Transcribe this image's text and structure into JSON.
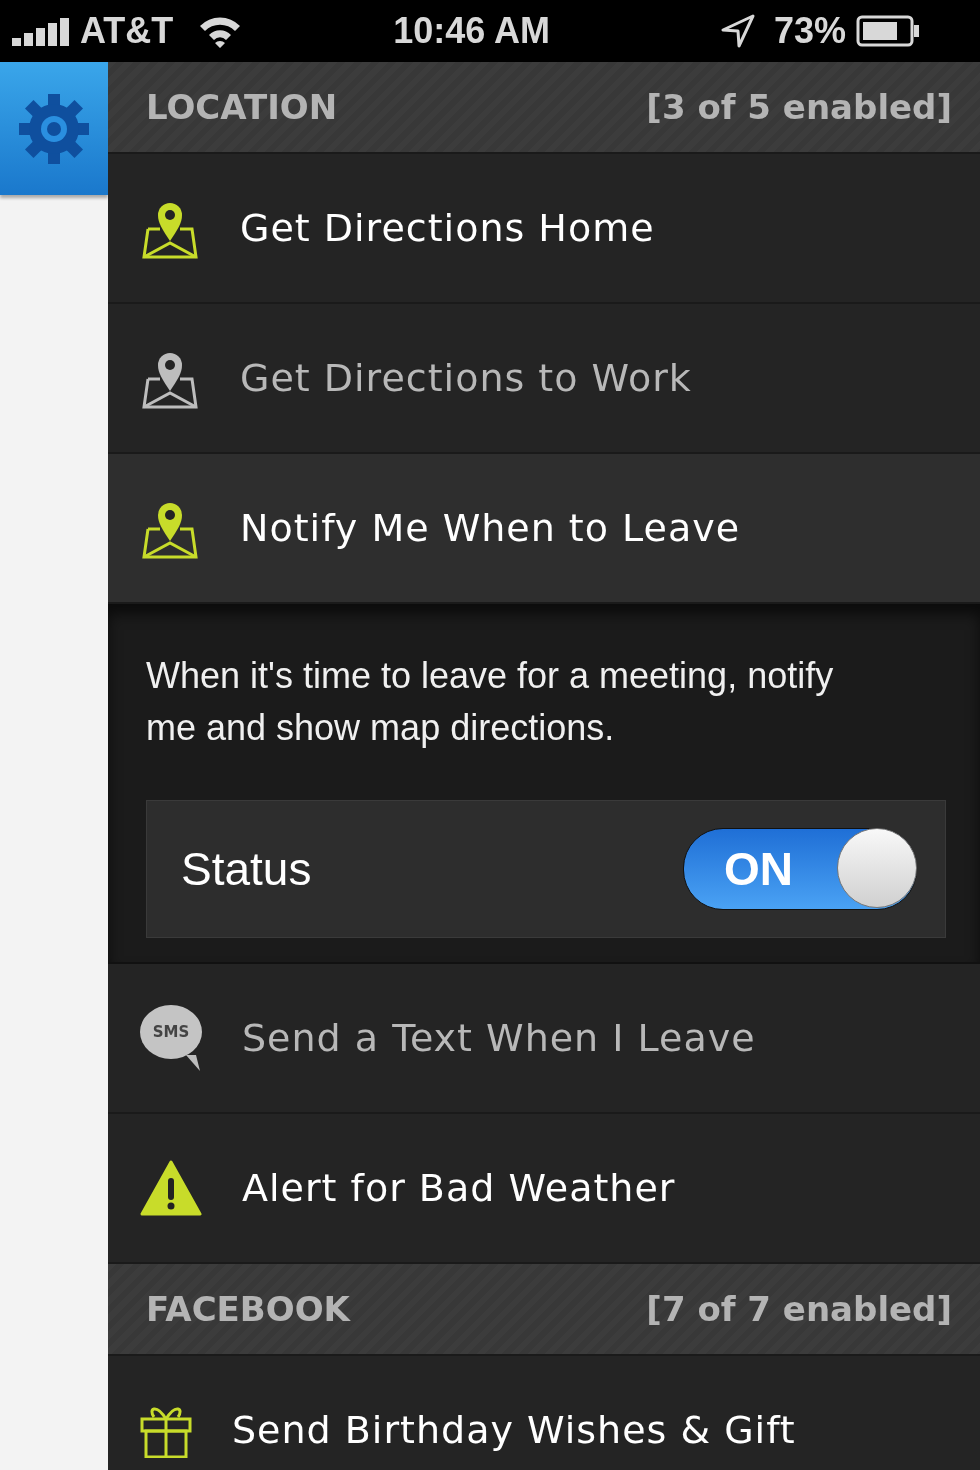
{
  "status_bar": {
    "carrier": "AT&T",
    "time": "10:46 AM",
    "battery": "73%"
  },
  "sections": [
    {
      "title": "LOCATION",
      "count": "[3 of 5 enabled]",
      "items": [
        {
          "kind": "location",
          "label": "Get Directions Home",
          "enabled": true,
          "expanded": false
        },
        {
          "kind": "location",
          "label": "Get Directions to Work",
          "enabled": false,
          "expanded": false
        },
        {
          "kind": "location",
          "label": "Notify Me When to Leave",
          "enabled": true,
          "expanded": true,
          "description": "When it's time to leave for a meeting, notify me and show map directions.",
          "status_label": "Status",
          "status_text": "ON",
          "on": true
        },
        {
          "kind": "sms",
          "label": "Send a Text When I Leave",
          "enabled": false,
          "expanded": false,
          "icon_text": "SMS"
        },
        {
          "kind": "alert",
          "label": "Alert for Bad Weather",
          "enabled": true,
          "expanded": false
        }
      ]
    },
    {
      "title": "FACEBOOK",
      "count": "[7 of 7 enabled]",
      "items": [
        {
          "kind": "gift",
          "label": "Send Birthday Wishes & Gift",
          "enabled": true,
          "expanded": false
        }
      ]
    }
  ]
}
